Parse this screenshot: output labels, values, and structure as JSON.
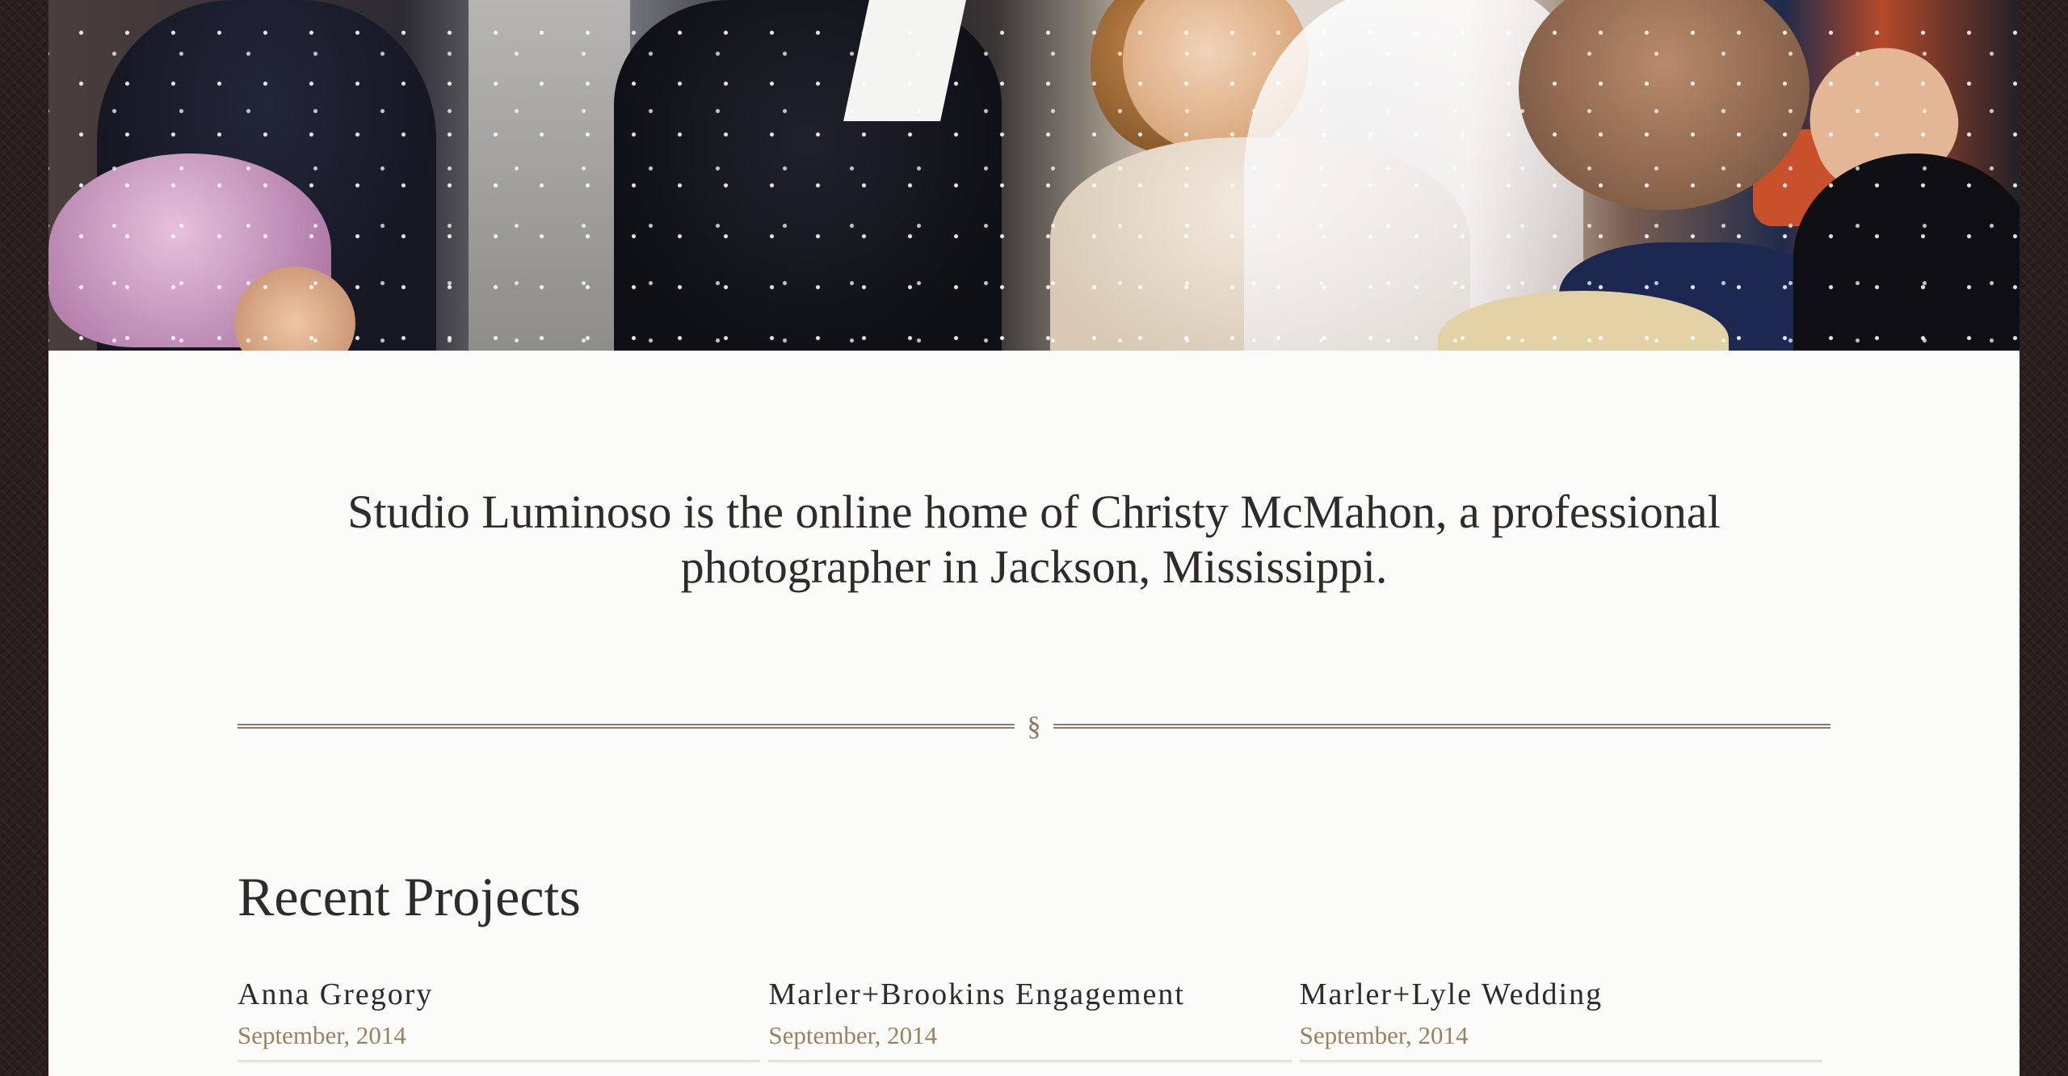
{
  "hero": {
    "image_description": "",
    "colors": {
      "suit": "#151722",
      "dress": "#f4ebe0",
      "veil": "#eeeeef",
      "brown_hat": "#7d5a44",
      "pink_hat": "#b07ba8",
      "navy_coat": "#1d2850"
    }
  },
  "intro": {
    "text": "Studio Luminoso is the online home of Christy McMahon, a professional photographer in Jackson, Mississippi."
  },
  "divider": {
    "symbol": "§"
  },
  "recent_projects": {
    "title": "Recent Projects",
    "items": [
      {
        "name": "Anna Gregory",
        "date": "September, 2014"
      },
      {
        "name": "Marler+Brookins Engagement",
        "date": "September, 2014"
      },
      {
        "name": "Marler+Lyle Wedding",
        "date": "September, 2014"
      }
    ]
  },
  "colors": {
    "background": "#2a1f1c",
    "page": "#fbfbfa",
    "text": "#2e2b28",
    "accent_date": "#9b825e",
    "divider": "#8c7b6e"
  }
}
